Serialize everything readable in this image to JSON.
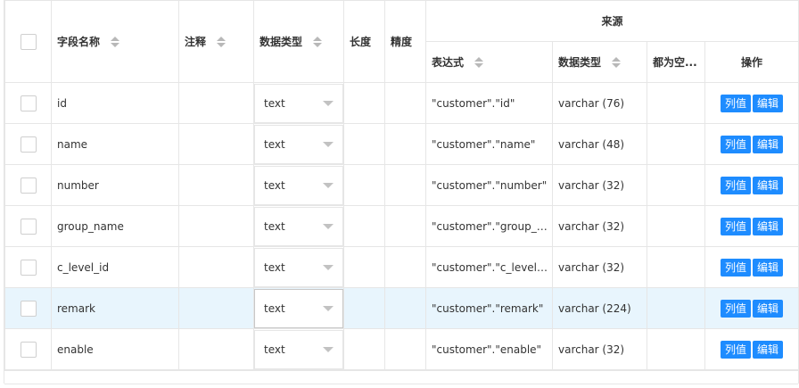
{
  "header": {
    "field_name": "字段名称",
    "comment": "注释",
    "data_type": "数据类型",
    "length": "长度",
    "precision": "精度",
    "source_group": "来源",
    "expression": "表达式",
    "source_type": "数据类型",
    "nullable": "都为空...",
    "operations": "操作"
  },
  "buttons": {
    "column_value": "列值",
    "edit": "编辑"
  },
  "rows": [
    {
      "name": "id",
      "type": "text",
      "expr": "\"customer\".\"id\"",
      "src_type": "varchar (76)"
    },
    {
      "name": "name",
      "type": "text",
      "expr": "\"customer\".\"name\"",
      "src_type": "varchar (48)"
    },
    {
      "name": "number",
      "type": "text",
      "expr": "\"customer\".\"number\"",
      "src_type": "varchar (32)"
    },
    {
      "name": "group_name",
      "type": "text",
      "expr": "\"customer\".\"group_na...",
      "src_type": "varchar (32)"
    },
    {
      "name": "c_level_id",
      "type": "text",
      "expr": "\"customer\".\"c_level_id\"",
      "src_type": "varchar (32)"
    },
    {
      "name": "remark",
      "type": "text",
      "expr": "\"customer\".\"remark\"",
      "src_type": "varchar (224)"
    },
    {
      "name": "enable",
      "type": "text",
      "expr": "\"customer\".\"enable\"",
      "src_type": "varchar (32)"
    }
  ],
  "highlighted_row_index": 5
}
